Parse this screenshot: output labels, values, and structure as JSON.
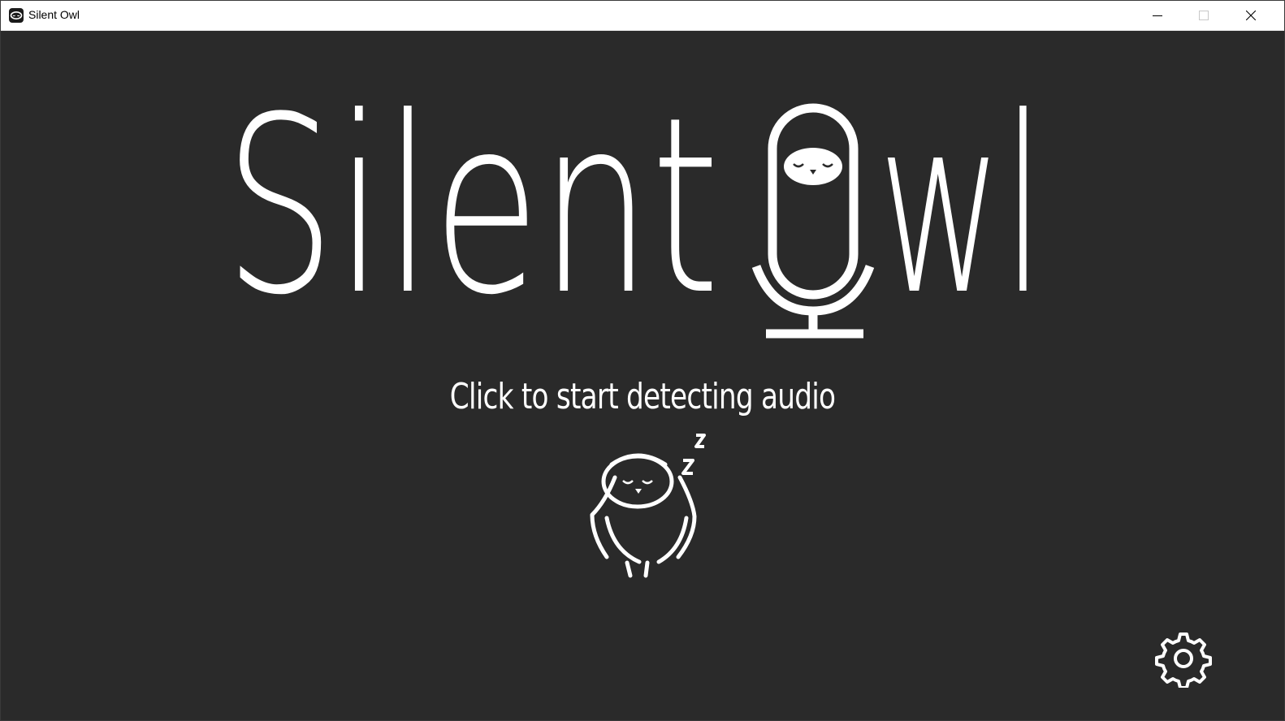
{
  "window": {
    "title": "Silent Owl",
    "controls": {
      "minimize": "minimize-icon",
      "maximize": "maximize-icon",
      "close": "close-icon"
    }
  },
  "logo": {
    "text": "Silent Owl",
    "part1": "Silent",
    "part2_tail": "wl"
  },
  "main": {
    "prompt": "Click to start detecting audio"
  },
  "colors": {
    "background": "#2a2a2a",
    "foreground": "#ffffff",
    "titlebar": "#ffffff"
  },
  "icons": {
    "app": "owl-app-icon",
    "microphone": "microphone-owl-icon",
    "sleeping_owl": "sleeping-owl-icon",
    "settings": "gear-icon"
  }
}
